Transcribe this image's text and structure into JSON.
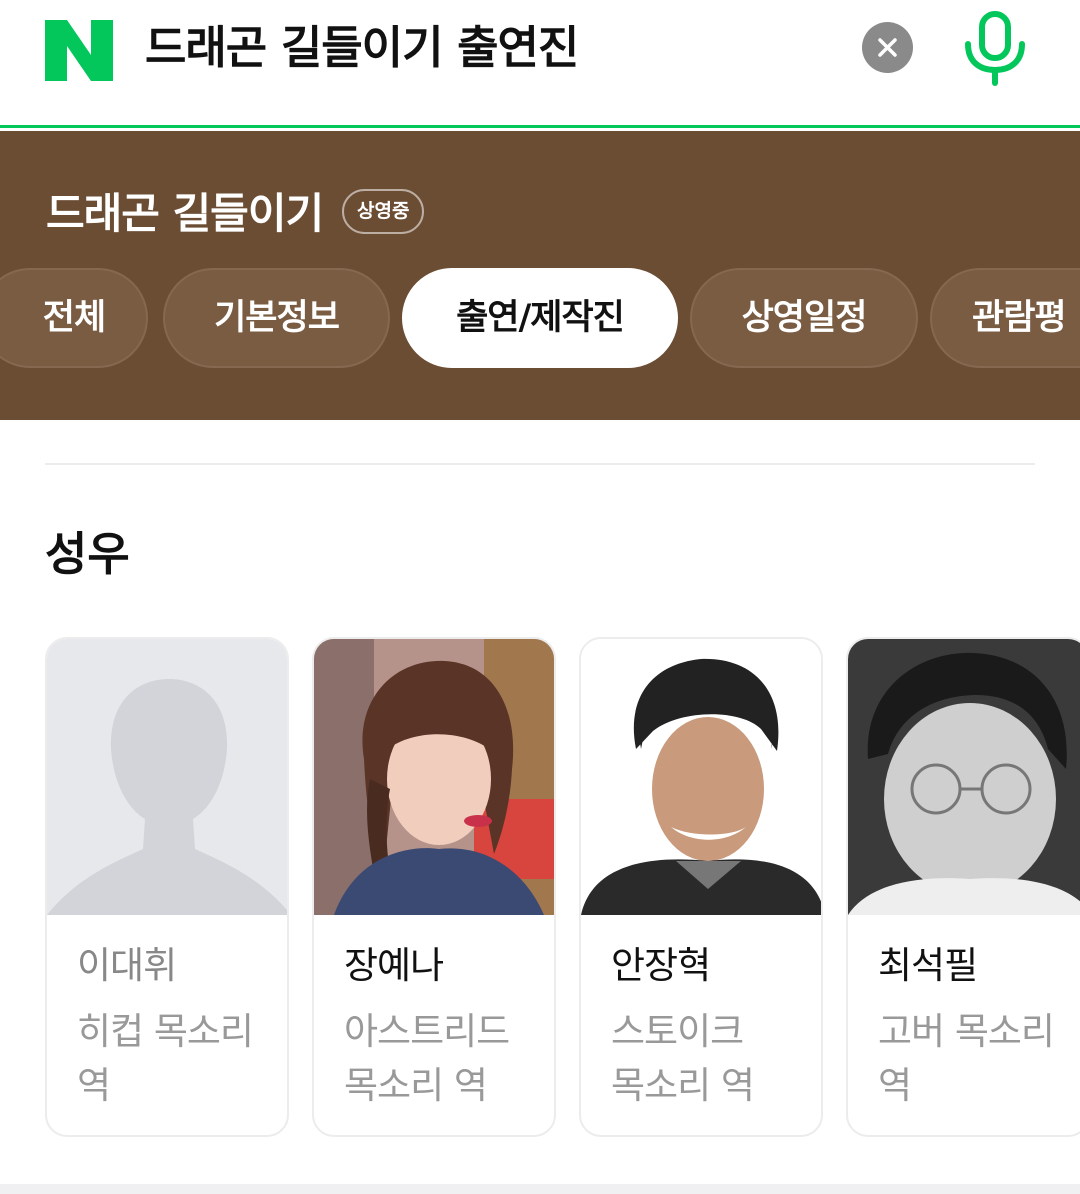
{
  "search": {
    "logo_text": "N",
    "query": "드래곤 길들이기 출연진",
    "clear_icon": "close-icon",
    "mic_icon": "microphone-icon"
  },
  "movie": {
    "title": "드래곤 길들이기",
    "status_badge": "상영중"
  },
  "tabs": [
    {
      "label": "전체",
      "active": false
    },
    {
      "label": "기본정보",
      "active": false
    },
    {
      "label": "출연/제작진",
      "active": true
    },
    {
      "label": "상영일정",
      "active": false
    },
    {
      "label": "관람평",
      "active": false
    }
  ],
  "section": {
    "title": "성우"
  },
  "cast": [
    {
      "name": "이대휘",
      "role": "히컵 목소리 역",
      "has_photo": false
    },
    {
      "name": "장예나",
      "role": "아스트리드 목소리 역",
      "has_photo": true
    },
    {
      "name": "안장혁",
      "role": "스토이크 목소리 역",
      "has_photo": true
    },
    {
      "name": "최석필",
      "role": "고버 목소리 역",
      "has_photo": true
    }
  ],
  "colors": {
    "brand_green": "#03c75a",
    "band_brown": "#6b4d34"
  }
}
